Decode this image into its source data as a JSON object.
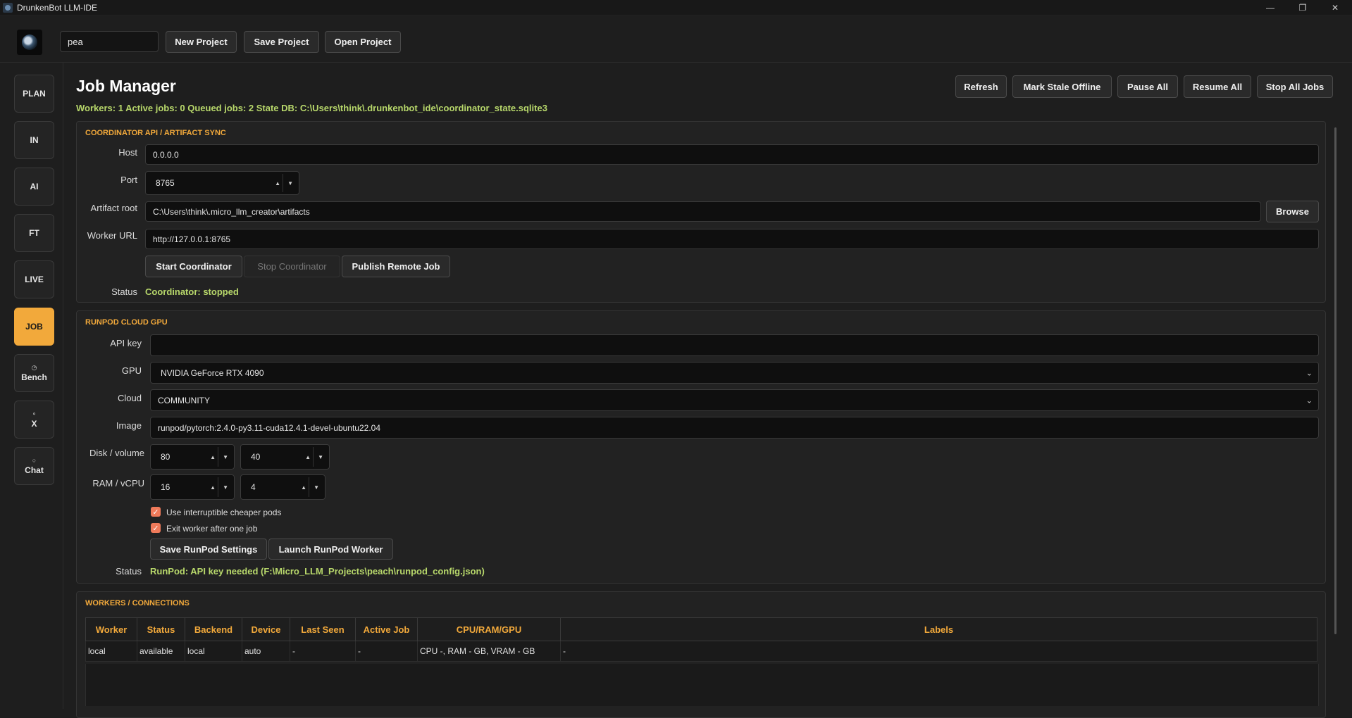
{
  "window": {
    "title": "DrunkenBot LLM-IDE"
  },
  "toolbar": {
    "project_value": "pea",
    "new_project": "New Project",
    "save_project": "Save Project",
    "open_project": "Open Project"
  },
  "sidebar": {
    "items": [
      {
        "label": "PLAN",
        "icon": ""
      },
      {
        "label": "IN",
        "icon": ""
      },
      {
        "label": "AI",
        "icon": ""
      },
      {
        "label": "FT",
        "icon": ""
      },
      {
        "label": "LIVE",
        "icon": ""
      },
      {
        "label": "JOB",
        "icon": "",
        "active": true
      },
      {
        "label": "Bench",
        "icon": "◷"
      },
      {
        "label": "X",
        "icon": "⚬"
      },
      {
        "label": "Chat",
        "icon": "○"
      }
    ]
  },
  "header": {
    "title": "Job Manager",
    "stats": "Workers: 1  Active jobs: 0  Queued jobs: 2  State DB: C:\\Users\\think\\.drunkenbot_ide\\coordinator_state.sqlite3",
    "actions": {
      "refresh": "Refresh",
      "mark_stale": "Mark Stale Offline",
      "pause_all": "Pause All",
      "resume_all": "Resume All",
      "stop_all": "Stop All Jobs"
    }
  },
  "coordinator": {
    "title": "COORDINATOR API / ARTIFACT SYNC",
    "host_label": "Host",
    "host_value": "0.0.0.0",
    "port_label": "Port",
    "port_value": "8765",
    "artifact_label": "Artifact root",
    "artifact_value": "C:\\Users\\think\\.micro_llm_creator\\artifacts",
    "browse": "Browse",
    "worker_url_label": "Worker URL",
    "worker_url_value": "http://127.0.0.1:8765",
    "start": "Start Coordinator",
    "stop": "Stop Coordinator",
    "publish": "Publish Remote Job",
    "status_label": "Status",
    "status_value": "Coordinator: stopped"
  },
  "runpod": {
    "title": "RUNPOD CLOUD GPU",
    "api_key_label": "API key",
    "api_key_value": "",
    "gpu_label": "GPU",
    "gpu_value": "NVIDIA GeForce RTX 4090",
    "cloud_label": "Cloud",
    "cloud_value": "COMMUNITY",
    "image_label": "Image",
    "image_value": "runpod/pytorch:2.4.0-py3.11-cuda12.4.1-devel-ubuntu22.04",
    "disk_label": "Disk / volume",
    "disk_value": "80",
    "volume_value": "40",
    "ram_label": "RAM / vCPU",
    "ram_value": "16",
    "vcpu_value": "4",
    "interruptible_label": "Use interruptible cheaper pods",
    "interruptible_checked": true,
    "exit_label": "Exit worker after one job",
    "exit_checked": true,
    "save": "Save RunPod Settings",
    "launch": "Launch RunPod Worker",
    "status_label": "Status",
    "status_value": "RunPod: API key needed (F:\\Micro_LLM_Projects\\peach\\runpod_config.json)"
  },
  "workers": {
    "title": "WORKERS / CONNECTIONS",
    "columns": [
      "Worker",
      "Status",
      "Backend",
      "Device",
      "Last Seen",
      "Active Job",
      "CPU/RAM/GPU",
      "Labels"
    ],
    "rows": [
      [
        "local",
        "available",
        "local",
        "auto",
        "-",
        "-",
        "CPU -, RAM - GB, VRAM - GB",
        "-"
      ]
    ]
  },
  "colors": {
    "accent": "#f2a93b",
    "status_green": "#b8d86b",
    "checkbox": "#ef7a5a"
  }
}
